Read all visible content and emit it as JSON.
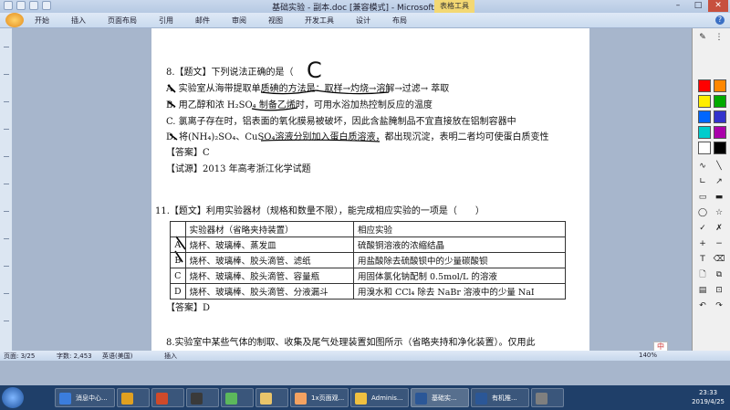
{
  "window": {
    "title": "基础实验 - 副本.doc [兼容模式] - Microsoft Word",
    "context_tab": "表格工具"
  },
  "ribbon": {
    "tabs": [
      "开始",
      "插入",
      "页面布局",
      "引用",
      "邮件",
      "审阅",
      "视图",
      "开发工具",
      "设计",
      "布局"
    ]
  },
  "document": {
    "q8_head": "8.【题文】下列说法正确的是（",
    "q8_answer_mark": "C",
    "q8_optA": "A. 实验室从海带提取单质碘的方法是：取样→灼烧→溶解→过滤→ 萃取",
    "q8_optB": "B. 用乙醇和浓 H₂SO₄ 制备乙烯时，可用水浴加热控制反应的温度",
    "q8_optC": "C. 氯离子存在时，铝表面的氧化膜易被破坏，因此含盐腌制品不宜直接放在铝制容器中",
    "q8_optD": "D. 将(NH₄)₂SO₄、CuSO₄溶液分别加入蛋白质溶液，都出现沉淀，表明二者均可使蛋白质变性",
    "q8_answer": "【答案】C",
    "q8_source": "【试源】2013 年高考浙江化学试题",
    "q11_head": "11.【题文】利用实验器材（规格和数量不限），能完成相应实验的一项是（　　）",
    "table": {
      "headers": [
        "",
        "实验器材（省略夹持装置）",
        "相应实验"
      ],
      "rows": [
        {
          "label": "A",
          "equipment": "烧杯、玻璃棒、蒸发皿",
          "experiment": "硫酸铜溶液的浓缩结晶"
        },
        {
          "label": "B",
          "equipment": "烧杯、玻璃棒、胶头滴管、滤纸",
          "experiment": "用盐酸除去硫酸钡中的少量碳酸钡"
        },
        {
          "label": "C",
          "equipment": "烧杯、玻璃棒、胶头滴管、容量瓶",
          "experiment": "用固体氯化钠配制 0.5mol/L 的溶液"
        },
        {
          "label": "D",
          "equipment": "烧杯、玻璃棒、胶头滴管、分液漏斗",
          "experiment": "用溴水和 CCl₄ 除去 NaBr 溶液中的少量 NaI"
        }
      ]
    },
    "q11_answer": "【答案】D",
    "q8b_head": "8.实验室中某些气体的制取、收集及尾气处理装置如图所示（省略夹持和净化装置）。仅用此"
  },
  "statusbar": {
    "page": "页面: 3/25",
    "words": "字数: 2,453",
    "lang": "英语(美国)",
    "mode": "插入",
    "zoom": "140%"
  },
  "ime": "中",
  "taskbar": {
    "items": [
      "消息中心...",
      "",
      "",
      "",
      "",
      "",
      "1x页面观...",
      "Adminis...",
      "基础实...",
      "有机推...",
      ""
    ],
    "time": "23:33",
    "date": "2019/4/25"
  },
  "colors": {
    "swatches": [
      "#ff0000",
      "#ff8800",
      "#ffee00",
      "#00aa00",
      "#0066ff",
      "#3333cc",
      "#00cccc",
      "#aa00aa",
      "#ffffff",
      "#000000"
    ]
  }
}
